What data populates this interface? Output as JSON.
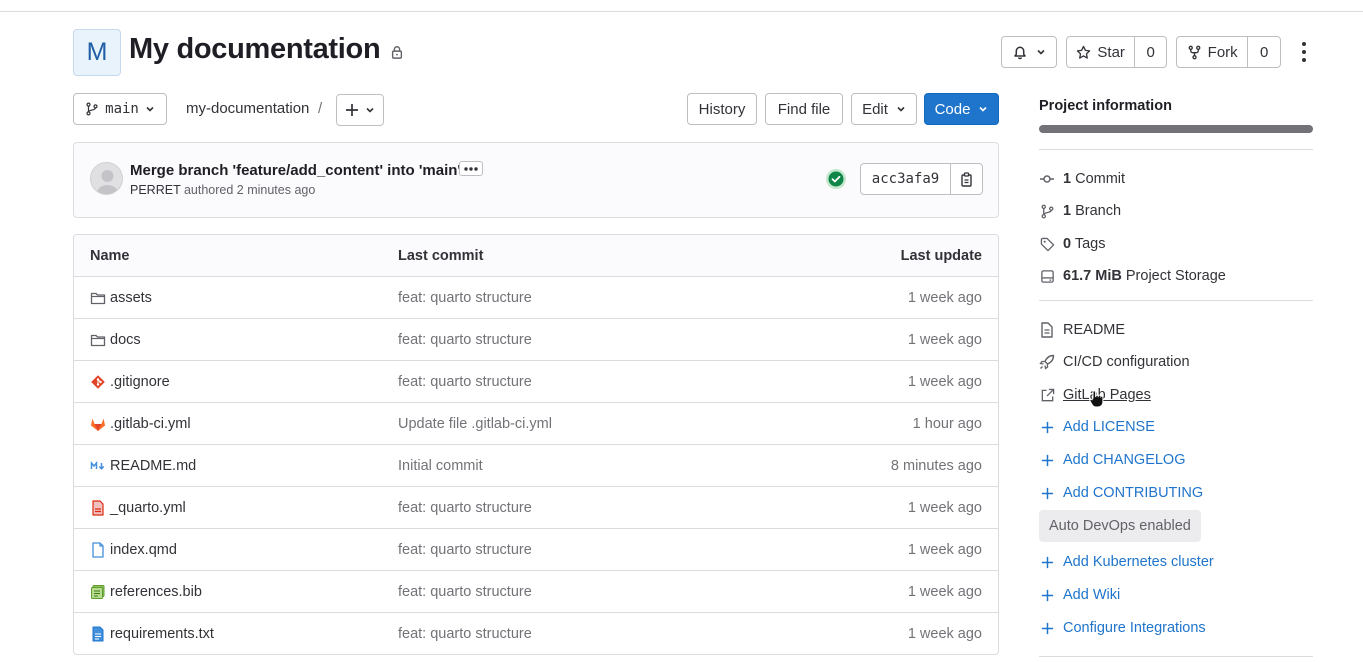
{
  "project": {
    "avatar_letter": "M",
    "title": "My documentation"
  },
  "header_actions": {
    "star_label": "Star",
    "star_count": "0",
    "fork_label": "Fork",
    "fork_count": "0"
  },
  "toolbar": {
    "branch": "main",
    "breadcrumb": "my-documentation",
    "breadcrumb_sep": "/",
    "history_label": "History",
    "find_file_label": "Find file",
    "edit_label": "Edit",
    "code_label": "Code"
  },
  "last_commit": {
    "title": "Merge branch 'feature/add_content' into 'main'",
    "author": "PERRET",
    "authored_text": "authored 2 minutes ago",
    "sha": "acc3afa9",
    "status_color": "#108548"
  },
  "file_table": {
    "headers": {
      "name": "Name",
      "last_commit": "Last commit",
      "last_update": "Last update"
    },
    "rows": [
      {
        "icon": "folder-icon",
        "name": "assets",
        "commit": "feat: quarto structure",
        "date": "1 week ago"
      },
      {
        "icon": "folder-icon",
        "name": "docs",
        "commit": "feat: quarto structure",
        "date": "1 week ago"
      },
      {
        "icon": "git-icon",
        "name": ".gitignore",
        "commit": "feat: quarto structure",
        "date": "1 week ago"
      },
      {
        "icon": "gitlab-icon",
        "name": ".gitlab-ci.yml",
        "commit": "Update file .gitlab-ci.yml",
        "date": "1 hour ago"
      },
      {
        "icon": "markdown-icon",
        "name": "README.md",
        "commit": "Initial commit",
        "date": "8 minutes ago"
      },
      {
        "icon": "yaml-file-icon",
        "name": "_quarto.yml",
        "commit": "feat: quarto structure",
        "date": "1 week ago"
      },
      {
        "icon": "file-icon",
        "name": "index.qmd",
        "commit": "feat: quarto structure",
        "date": "1 week ago"
      },
      {
        "icon": "bib-file-icon",
        "name": "references.bib",
        "commit": "feat: quarto structure",
        "date": "1 week ago"
      },
      {
        "icon": "text-file-icon",
        "name": "requirements.txt",
        "commit": "feat: quarto structure",
        "date": "1 week ago"
      }
    ]
  },
  "sidebar": {
    "title": "Project information",
    "stats": {
      "commits_num": "1",
      "commits_label": "Commit",
      "branches_num": "1",
      "branches_label": "Branch",
      "tags_num": "0",
      "tags_label": "Tags",
      "storage_num": "61.7 MiB",
      "storage_label": "Project Storage"
    },
    "links": {
      "readme": "README",
      "cicd": "CI/CD configuration",
      "pages": "GitLab Pages",
      "add_license": "Add LICENSE",
      "add_changelog": "Add CHANGELOG",
      "add_contributing": "Add CONTRIBUTING",
      "auto_devops": "Auto DevOps enabled",
      "add_k8s": "Add Kubernetes cluster",
      "add_wiki": "Add Wiki",
      "configure_integrations": "Configure Integrations"
    }
  },
  "colors": {
    "primary": "#1f75cb",
    "link": "#1f75cb",
    "success": "#108548"
  }
}
